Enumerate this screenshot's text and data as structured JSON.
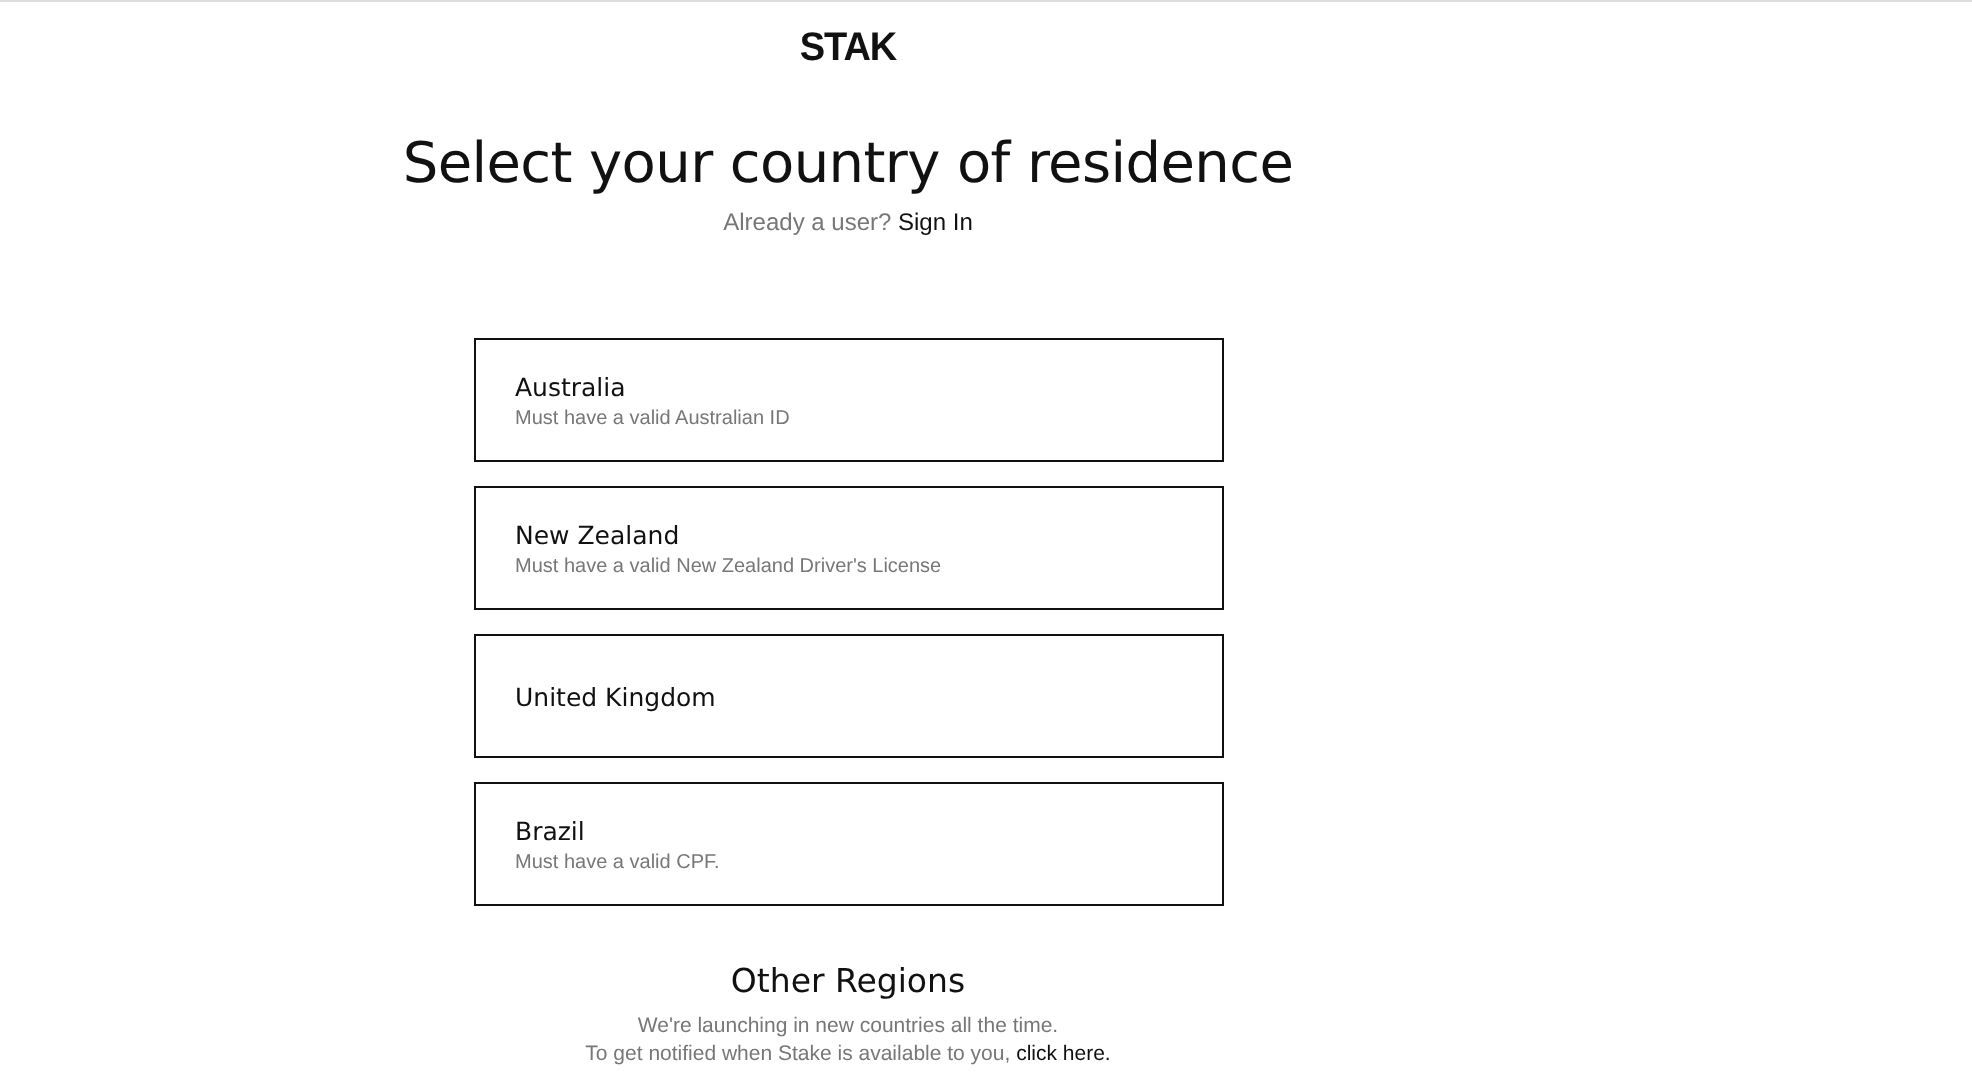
{
  "logo": "STAK",
  "title": "Select your country of residence",
  "signin": {
    "prompt": "Already a user?",
    "link": "Sign In"
  },
  "countries": [
    {
      "name": "Australia",
      "requirement": "Must have a valid Australian ID"
    },
    {
      "name": "New Zealand",
      "requirement": "Must have a valid New Zealand Driver's License"
    },
    {
      "name": "United Kingdom"
    },
    {
      "name": "Brazil",
      "requirement": "Must have a valid CPF."
    }
  ],
  "other_regions": {
    "heading": "Other Regions",
    "line_1": "We're launching in new countries all the time.",
    "line_2": "To get notified when Stake is available to you,",
    "link": "click here."
  }
}
